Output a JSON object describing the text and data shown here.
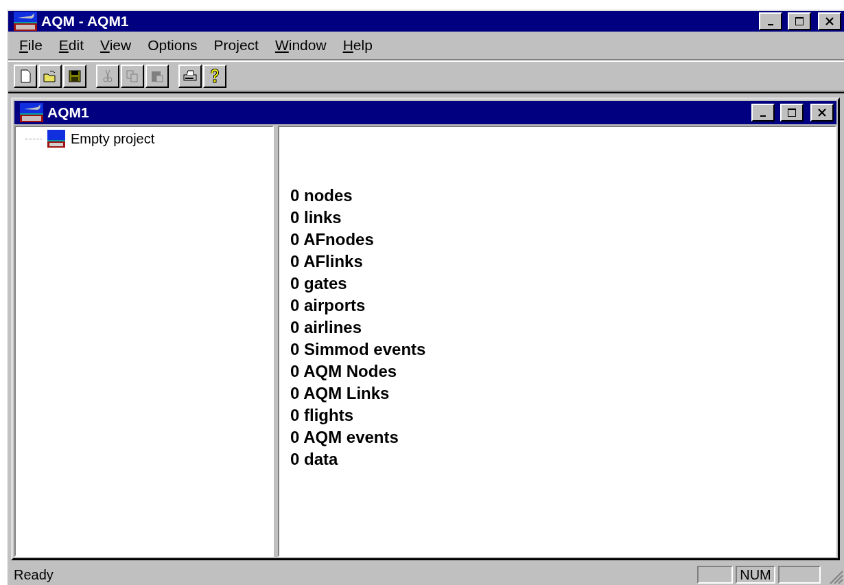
{
  "window": {
    "title": "AQM - AQM1"
  },
  "menu": [
    {
      "label": "File",
      "mnemonic": true
    },
    {
      "label": "Edit",
      "mnemonic": true
    },
    {
      "label": "View",
      "mnemonic": true
    },
    {
      "label": "Options",
      "mnemonic": false
    },
    {
      "label": "Project",
      "mnemonic": false
    },
    {
      "label": "Window",
      "mnemonic": true
    },
    {
      "label": "Help",
      "mnemonic": true
    }
  ],
  "toolbar": [
    [
      {
        "kind": "new",
        "disabled": false
      },
      {
        "kind": "open",
        "disabled": false
      },
      {
        "kind": "save",
        "disabled": false
      }
    ],
    [
      {
        "kind": "cut",
        "disabled": true
      },
      {
        "kind": "copy",
        "disabled": true
      },
      {
        "kind": "paste",
        "disabled": true
      }
    ],
    [
      {
        "kind": "print",
        "disabled": false
      },
      {
        "kind": "help",
        "disabled": false
      }
    ]
  ],
  "child": {
    "title": "AQM1",
    "tree": [
      {
        "label": "Empty project"
      }
    ],
    "counts": [
      "0 nodes",
      "0 links",
      "0 AFnodes",
      "0 AFlinks",
      "0 gates",
      "0 airports",
      "0 airlines",
      "0 Simmod events",
      "0 AQM Nodes",
      "0 AQM Links",
      "0 flights",
      "0 AQM events",
      "0 data"
    ]
  },
  "status_bar": {
    "text": "Ready",
    "num_indicator": "NUM"
  }
}
